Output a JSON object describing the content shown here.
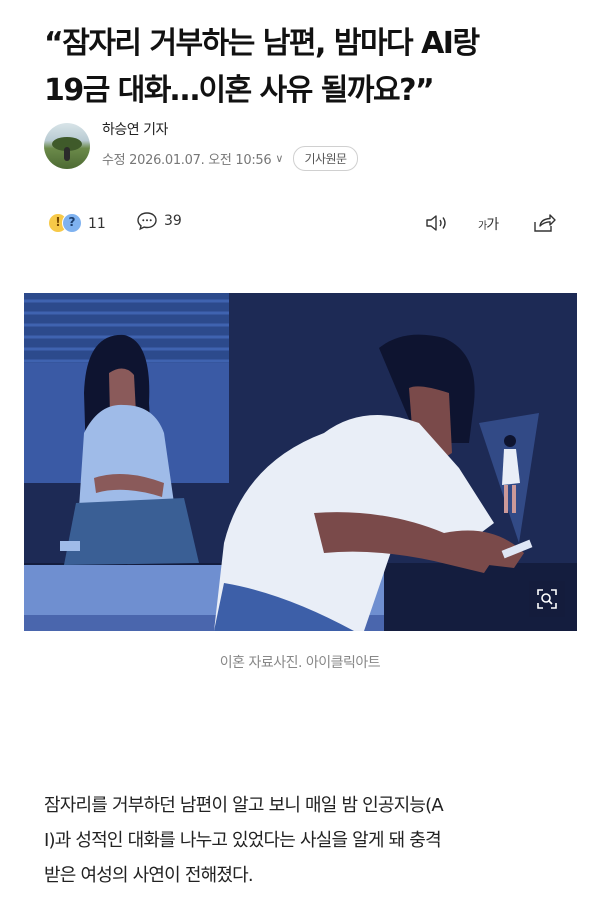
{
  "article": {
    "headline_line1": "“잠자리 거부하는 남편, 밤마다 AI랑",
    "headline_line2": "19금 대화…이혼 사유 될까요?”"
  },
  "byline": {
    "reporter": "하승연 기자",
    "date": "수정 2026.01.07. 오전 10:56",
    "original_button": "기사원문"
  },
  "actions": {
    "reaction_count": "11",
    "comment_count": "39",
    "font_size_label_small": "가",
    "font_size_label_large": "가"
  },
  "image": {
    "caption": "이혼 자료사진. 아이클릭아트"
  },
  "body": {
    "paragraph_line1": "잠자리를 거부하던 남편이 알고 보니 매일 밤 인공지능(A",
    "paragraph_line2": "I)과 성적인 대화를 나누고 있었다는 사실을 알게 돼 충격",
    "paragraph_line3": "받은 여성의 사연이 전해졌다."
  },
  "colors": {
    "illustration_navy": "#1e2a52",
    "illustration_blue": "#3d5fa8",
    "shirt_white": "#e9eef7"
  }
}
